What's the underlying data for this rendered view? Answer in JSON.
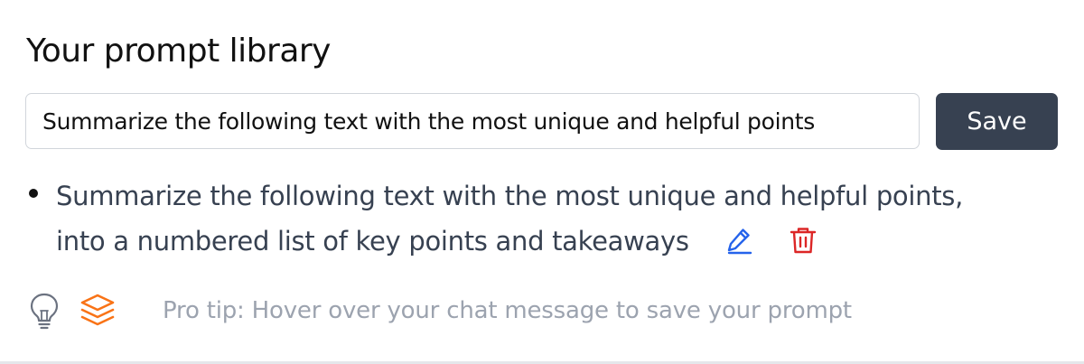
{
  "library": {
    "title": "Your prompt library",
    "input_value": "Summarize the following text with the most unique and helpful points",
    "save_label": "Save",
    "prompts": [
      {
        "text": "Summarize the following text with the most unique and helpful points, into a numbered list of key points and takeaways"
      }
    ],
    "tip": "Pro tip: Hover over your chat message to save your prompt"
  },
  "icons": {
    "edit": "pencil-icon",
    "delete": "trash-icon",
    "tip": "lightbulb-icon",
    "layers": "layers-icon"
  },
  "colors": {
    "save_button": "#374151",
    "edit_icon": "#2563eb",
    "delete_icon": "#dc2626",
    "layers_icon": "#f97316",
    "tip_text": "#9ca3af"
  }
}
